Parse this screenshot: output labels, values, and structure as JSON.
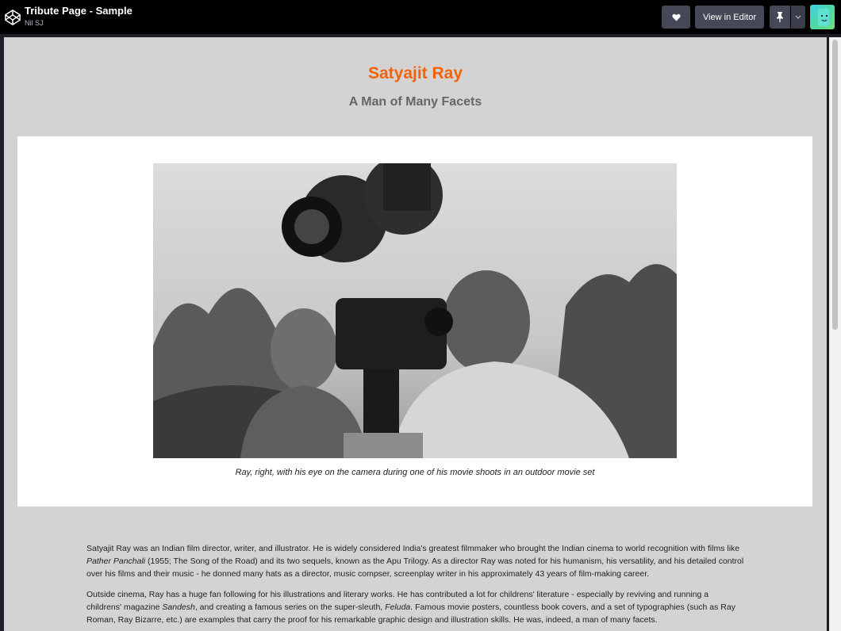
{
  "header": {
    "title": "Tribute Page - Sample",
    "author": "Nil SJ",
    "view_in_editor_label": "View in Editor",
    "icons": [
      "codepen-logo-icon",
      "heart-icon",
      "pin-icon",
      "chevron-down-icon",
      "avatar"
    ]
  },
  "page": {
    "title": "Satyajit Ray",
    "subtitle": "A Man of Many Facets",
    "caption": "Ray, right, with his eye on the camera during one of his movie shoots in an outdoor movie set",
    "bio": {
      "p1_a": "Satyajit Ray was an Indian film director, writer, and illustrator. He is widely considered India's greatest filmmaker who brought the Indian cinema to world recognition with films like ",
      "p1_em": "Pather Panchali",
      "p1_b": " (1955; The Song of the Road) and its two sequels, known as the Apu Trilogy. As a director Ray was noted for his humanism, his versatility, and his detailed control over his films and their music - he donned many hats as a director, music compser, screenplay writer in his approximately 43 years of film-making career.",
      "p2_a": "Outside cinema, Ray has a huge fan following for his illustrations and literary works. He has contributed a lot for childrens' literature - especially by reviving and running a childrens' magazine ",
      "p2_em1": "Sandesh",
      "p2_b": ", and creating a famous series on the super-sleuth, ",
      "p2_em2": "Feluda",
      "p2_c": ". Famous movie posters, countless book covers, and a set of typographies (such as Ray Roman, Ray Bizarre, etc.) are examples that carry the proof for his remarkable graphic design and illustration skills. He was, indeed, a man of many facets."
    }
  },
  "colors": {
    "title": "#f76207",
    "subtitle": "#666666",
    "page_bg": "#d3d3d3",
    "topbar_bg": "#000000",
    "button_bg": "#444857"
  }
}
